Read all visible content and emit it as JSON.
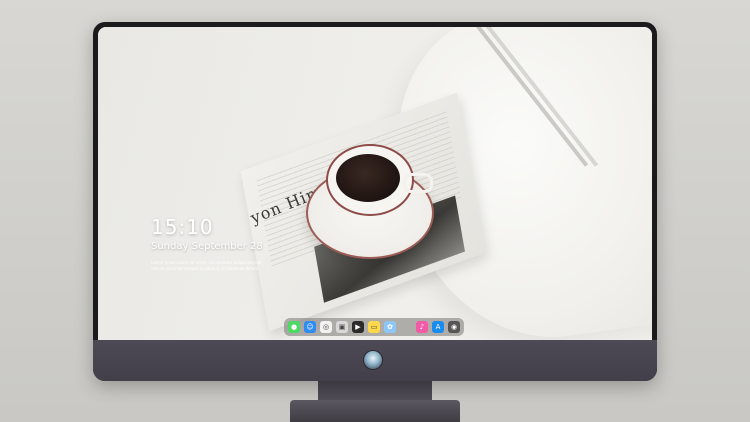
{
  "lock_screen": {
    "time": "15:10",
    "date": "Sunday September 28",
    "notification_line_1": "Lorem ipsum dolor sit amet, consectetur adipiscing elit",
    "notification_line_2": "sed do eiusmod tempor incididunt ut labore et dolore"
  },
  "wallpaper": {
    "newspaper_headline": "yon Himel"
  },
  "dock": {
    "items": [
      {
        "name": "messages-icon",
        "color": "#4cd964",
        "glyph": "●"
      },
      {
        "name": "finder-icon",
        "color": "#2f8cf0",
        "glyph": "☺"
      },
      {
        "name": "safari-icon",
        "color": "#f2f2f2",
        "glyph": "◎"
      },
      {
        "name": "preview-icon",
        "color": "#d8d8d8",
        "glyph": "▣"
      },
      {
        "name": "final-cut-icon",
        "color": "#2b2b2b",
        "glyph": "▶"
      },
      {
        "name": "notes-icon",
        "color": "#ffd94a",
        "glyph": "▭"
      },
      {
        "name": "photos-icon",
        "color": "#8ec7f5",
        "glyph": "✿"
      },
      {
        "name": "music-icon",
        "color": "#f35ba6",
        "glyph": "♪"
      },
      {
        "name": "app-store-icon",
        "color": "#1a8cf0",
        "glyph": "A"
      },
      {
        "name": "camera-icon",
        "color": "#555555",
        "glyph": "◉"
      }
    ]
  },
  "colors": {
    "bezel": "#1b1a1d",
    "chin": "#4a4650",
    "text": "#ffffff"
  }
}
